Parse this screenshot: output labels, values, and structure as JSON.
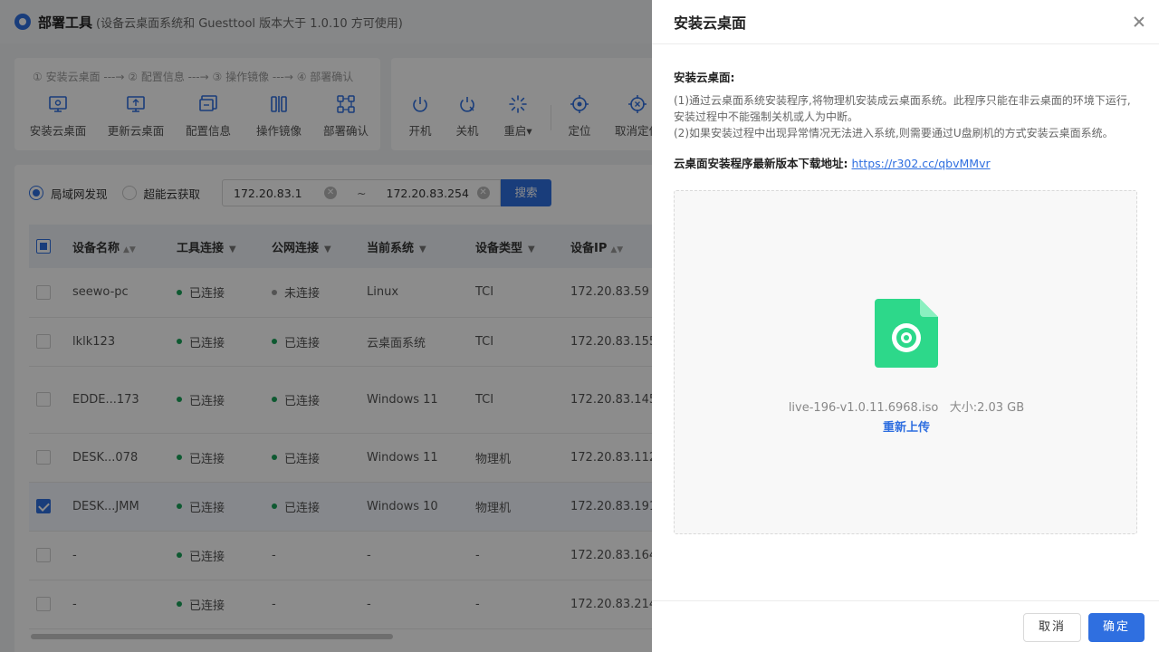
{
  "app": {
    "title": "部署工具",
    "subtitle": "(设备云桌面系统和 Guesttool 版本大于 1.0.10 方可使用)"
  },
  "toolbar": {
    "steps": "① 安装云桌面 ---→ ② 配置信息 ---→ ③ 操作镜像 ---→ ④ 部署确认",
    "deploy_tools": [
      {
        "label": "安装云桌面",
        "icon": "install-desktop-icon"
      },
      {
        "label": "更新云桌面",
        "icon": "update-desktop-icon"
      },
      {
        "label": "配置信息",
        "icon": "config-info-icon"
      },
      {
        "label": "操作镜像",
        "icon": "image-operation-icon"
      },
      {
        "label": "部署确认",
        "icon": "deploy-confirm-icon"
      }
    ],
    "power_tools": [
      {
        "label": "开机",
        "icon": "power-on-icon"
      },
      {
        "label": "关机",
        "icon": "power-off-icon"
      },
      {
        "label": "重启▾",
        "icon": "restart-icon"
      },
      {
        "label": "定位",
        "icon": "locate-icon"
      },
      {
        "label": "取消定位",
        "icon": "cancel-locate-icon"
      }
    ]
  },
  "filter": {
    "lan_discovery": "局域网发现",
    "cloud_fetch": "超能云获取",
    "ip_start": "172.20.83.1",
    "ip_end": "172.20.83.254",
    "tilde": "~",
    "search": "搜索"
  },
  "table": {
    "headers": [
      "设备名称",
      "工具连接",
      "公网连接",
      "当前系统",
      "设备类型",
      "设备IP"
    ],
    "rows": [
      {
        "name": "seewo-pc",
        "tool": "已连接",
        "net": "未连接",
        "os": "Linux",
        "type": "TCI",
        "ip": "172.20.83.59",
        "checked": false
      },
      {
        "name": "lklk123",
        "tool": "已连接",
        "net": "已连接",
        "os": "云桌面系统",
        "type": "TCI",
        "ip": "172.20.83.155",
        "checked": false
      },
      {
        "name": "EDDE...173",
        "tool": "已连接",
        "net": "已连接",
        "os": "Windows 11",
        "type": "TCI",
        "ip": "172.20.83.145",
        "checked": false
      },
      {
        "name": "DESK...078",
        "tool": "已连接",
        "net": "已连接",
        "os": "Windows 11",
        "type": "物理机",
        "ip": "172.20.83.112",
        "checked": false
      },
      {
        "name": "DESK...JMM",
        "tool": "已连接",
        "net": "已连接",
        "os": "Windows 10",
        "type": "物理机",
        "ip": "172.20.83.191",
        "checked": true
      },
      {
        "name": "-",
        "tool": "已连接",
        "net": "-",
        "os": "-",
        "type": "-",
        "ip": "172.20.83.164",
        "checked": false
      },
      {
        "name": "-",
        "tool": "已连接",
        "net": "-",
        "os": "-",
        "type": "-",
        "ip": "172.20.83.214",
        "checked": false
      }
    ]
  },
  "colors": {
    "accent": "#2f6fe0",
    "connected": "#1aa35a",
    "disconnected": "#9a9a9a",
    "file_icon": "#2dd88a"
  },
  "drawer": {
    "title": "安装云桌面",
    "section_title": "安装云桌面:",
    "desc_1": "(1)通过云桌面系统安装程序,将物理机安装成云桌面系统。此程序只能在非云桌面的环境下运行,安装过程中不能强制关机或人为中断。",
    "desc_2": "(2)如果安装过程中出现异常情况无法进入系统,则需要通过U盘刷机的方式安装云桌面系统。",
    "download_label": "云桌面安装程序最新版本下载地址:",
    "download_link": "https://r302.cc/qbvMMvr",
    "file_name": "live-196-v1.0.11.6968.iso",
    "file_size": "大小:2.03 GB",
    "reupload": "重新上传",
    "cancel": "取消",
    "confirm": "确定"
  }
}
